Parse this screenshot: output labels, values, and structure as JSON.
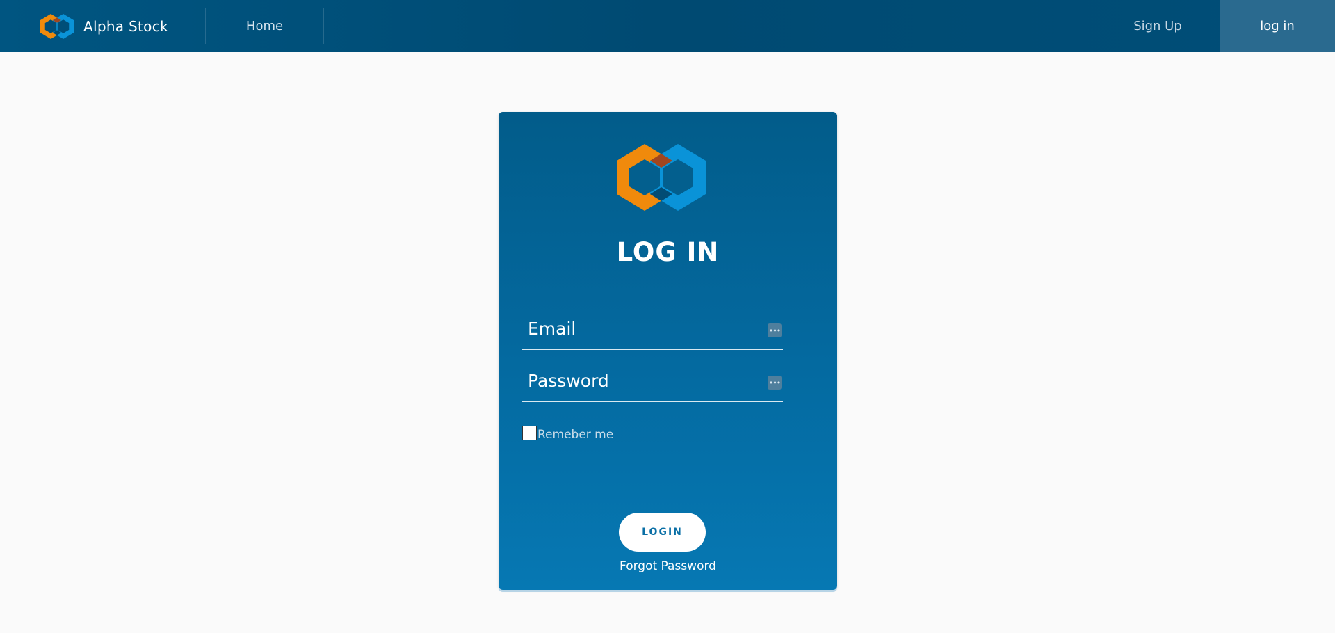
{
  "header": {
    "brand_name": "Alpha Stock",
    "nav_home": "Home",
    "nav_signup": "Sign Up",
    "nav_login": "log in"
  },
  "login_card": {
    "title": "LOG IN",
    "email_placeholder": "Email",
    "password_placeholder": "Password",
    "remember_label": "Remeber me",
    "login_button": "LOGIN",
    "forgot_password": "Forgot Password",
    "field_icon": "•••"
  },
  "icons": {
    "brand_logo": "hexagon-logo-icon",
    "field_icon": "password-manager-icon"
  },
  "colors": {
    "header_bg": "#004a72",
    "active_nav_bg": "#2a6a8f",
    "card_bg_top": "#025c8a",
    "card_bg_bottom": "#0678b3",
    "logo_orange": "#f08a0c",
    "logo_blue": "#0a93d8",
    "page_bg": "#fafafa"
  }
}
